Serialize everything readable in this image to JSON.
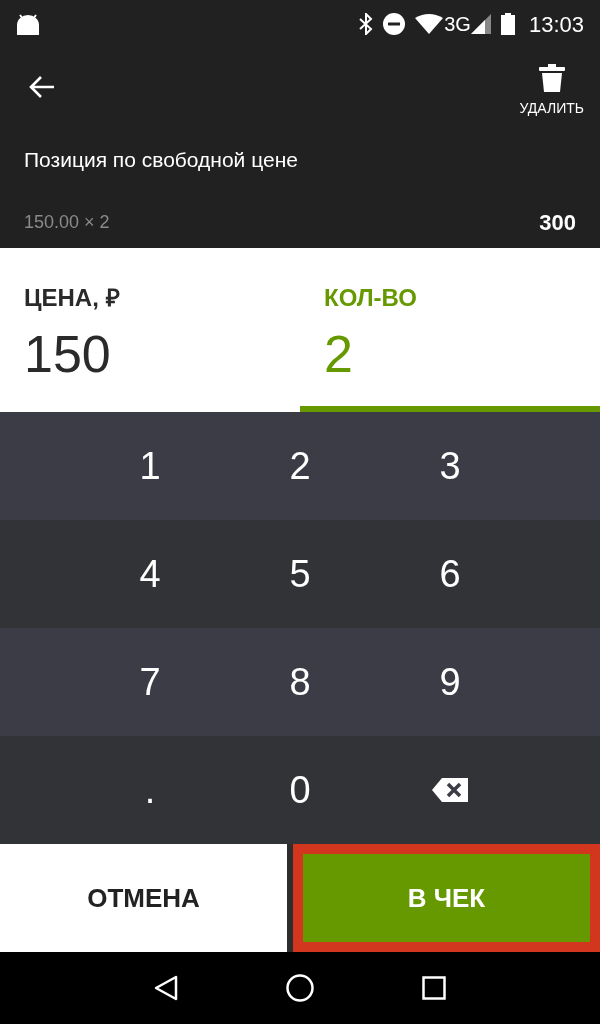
{
  "status_bar": {
    "network": "3G",
    "time": "13:03"
  },
  "toolbar": {
    "delete_label": "УДАЛИТЬ"
  },
  "item": {
    "title": "Позиция по свободной цене",
    "formula": "150.00 × 2",
    "total": "300"
  },
  "fields": [
    {
      "label": "ЦЕНА, ₽",
      "value": "150",
      "selected": false
    },
    {
      "label": "КОЛ-ВО",
      "value": "2",
      "selected": true
    }
  ],
  "keypad": [
    {
      "kind": "digit",
      "label": "1"
    },
    {
      "kind": "digit",
      "label": "2"
    },
    {
      "kind": "digit",
      "label": "3"
    },
    {
      "kind": "digit",
      "label": "4"
    },
    {
      "kind": "digit",
      "label": "5"
    },
    {
      "kind": "digit",
      "label": "6"
    },
    {
      "kind": "digit",
      "label": "7"
    },
    {
      "kind": "digit",
      "label": "8"
    },
    {
      "kind": "digit",
      "label": "9"
    },
    {
      "kind": "digit",
      "label": "."
    },
    {
      "kind": "digit",
      "label": "0"
    },
    {
      "kind": "backspace"
    }
  ],
  "buttons": [
    {
      "kind": "secondary",
      "label": "ОТМЕНА",
      "highlighted": false
    },
    {
      "kind": "primary",
      "label": "В ЧЕК",
      "highlighted": true
    }
  ]
}
